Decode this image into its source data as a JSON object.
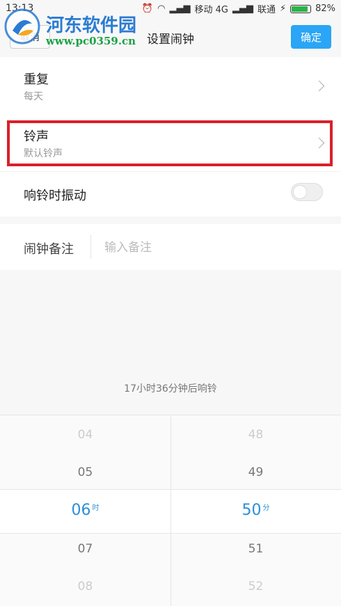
{
  "status_bar": {
    "time": "13:13",
    "carrier1": "移动 4G",
    "carrier2": "联通",
    "battery": "82%",
    "battery_level": 0.82
  },
  "watermark": {
    "title": "河东软件园",
    "url": "www.pc0359.cn"
  },
  "header": {
    "cancel_label": "取消",
    "title": "设置闹钟",
    "confirm_label": "确定"
  },
  "settings": {
    "repeat": {
      "title": "重复",
      "value": "每天"
    },
    "ringtone": {
      "title": "铃声",
      "value": "默认铃声"
    },
    "vibrate": {
      "title": "响铃时振动",
      "enabled": false
    }
  },
  "note": {
    "label": "闹钟备注",
    "placeholder": "输入备注"
  },
  "countdown": "17小时36分钟后响铃",
  "picker": {
    "hours": [
      "04",
      "05",
      "06",
      "07",
      "08"
    ],
    "minutes": [
      "48",
      "49",
      "50",
      "51",
      "52"
    ],
    "hour_unit": "时",
    "minute_unit": "分"
  },
  "colors": {
    "accent": "#2b8fd8",
    "confirm_bg": "#2ba5f5",
    "highlight": "#d9202a"
  }
}
